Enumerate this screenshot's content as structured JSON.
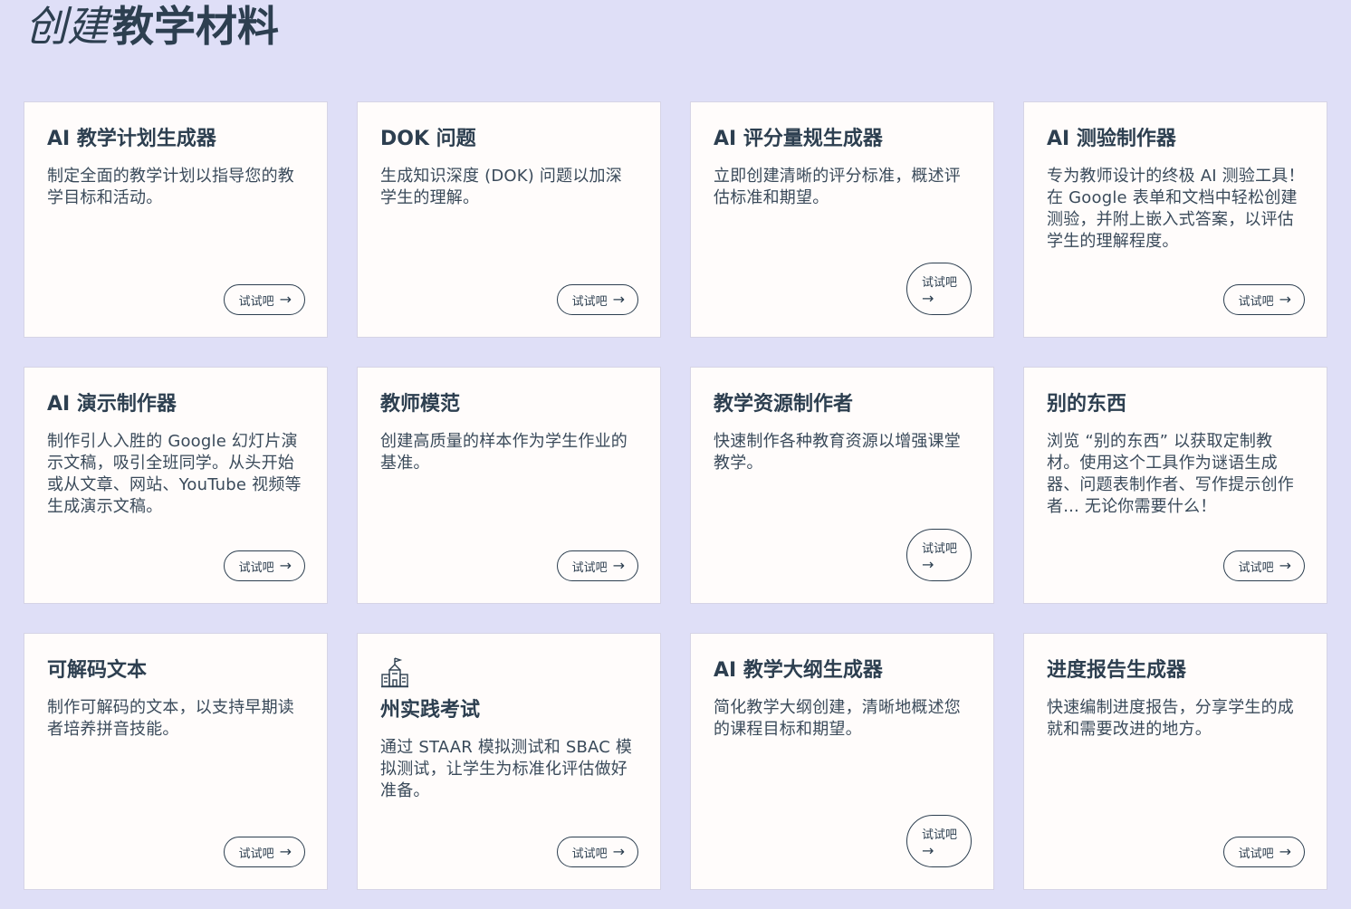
{
  "page": {
    "title_italic": "创建",
    "title_rest": "教学材料"
  },
  "cards": [
    {
      "title": "AI 教学计划生成器",
      "description": "制定全面的教学计划以指导您的教学目标和活动。",
      "button": "试试吧"
    },
    {
      "title": "DOK 问题",
      "description": "生成知识深度 (DOK) 问题以加深学生的理解。",
      "button": "试试吧"
    },
    {
      "title": "AI 评分量规生成器",
      "description": "立即创建清晰的评分标准，概述评估标准和期望。",
      "button": "试试吧"
    },
    {
      "title": "AI 测验制作器",
      "description": "专为教师设计的终极 AI 测验工具！在 Google 表单和文档中轻松创建测验，并附上嵌入式答案，以评估学生的理解程度。",
      "button": "试试吧"
    },
    {
      "title": "AI 演示制作器",
      "description": "制作引人入胜的 Google 幻灯片演示文稿，吸引全班同学。从头开始或从文章、网站、YouTube 视频等生成演示文稿。",
      "button": "试试吧"
    },
    {
      "title": "教师模范",
      "description": "创建高质量的样本作为学生作业的基准。",
      "button": "试试吧"
    },
    {
      "title": "教学资源制作者",
      "description": "快速制作各种教育资源以增强课堂教学。",
      "button": "试试吧"
    },
    {
      "title": "别的东西",
      "description": "浏览 “别的东西” 以获取定制教材。使用这个工具作为谜语生成器、问题表制作者、写作提示创作者... 无论你需要什么！",
      "button": "试试吧"
    },
    {
      "title": "可解码文本",
      "description": "制作可解码的文本，以支持早期读者培养拼音技能。",
      "button": "试试吧"
    },
    {
      "title": "州实践考试",
      "description": "通过 STAAR 模拟测试和 SBAC 模拟测试，让学生为标准化评估做好准备。",
      "button": "试试吧",
      "icon": "school-building-icon"
    },
    {
      "title": "AI 教学大纲生成器",
      "description": "简化教学大纲创建，清晰地概述您的课程目标和期望。",
      "button": "试试吧"
    },
    {
      "title": "进度报告生成器",
      "description": "快速编制进度报告，分享学生的成就和需要改进的地方。",
      "button": "试试吧"
    }
  ]
}
